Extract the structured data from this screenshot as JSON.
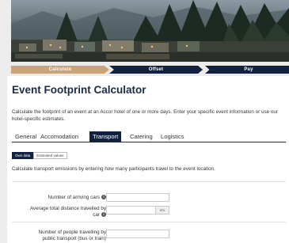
{
  "progress": {
    "steps": [
      {
        "label": "Calculate"
      },
      {
        "label": "Offset"
      },
      {
        "label": "Pay"
      }
    ]
  },
  "header": {
    "title": "Event Footprint Calculator",
    "intro": "Calculate the footprint of an event at an Accor hotel of one or more days. Enter your specific event information or use our hotel-specific estimates."
  },
  "tabs": [
    {
      "label": "General"
    },
    {
      "label": "Accomodation"
    },
    {
      "label": "Transport"
    },
    {
      "label": "Catering"
    },
    {
      "label": "Logistics"
    }
  ],
  "active_tab": "Transport",
  "data_toggle": {
    "own_label": "Own data",
    "estimated_label": "Estimated values"
  },
  "transport": {
    "description": "Calculate transport emissions by entering how many participants travel to the event location.",
    "cars_label": "Number of arriving cars",
    "cars_value": "",
    "distance_label_1": "Average total distance travelled by",
    "distance_label_2": "car",
    "distance_value": "",
    "distance_unit": "km",
    "public_label_1": "Number of people travelling by",
    "public_label_2": "public transport (bus or train)",
    "public_value": ""
  },
  "colors": {
    "navy": "#12213f",
    "tan": "#c9a37a"
  }
}
